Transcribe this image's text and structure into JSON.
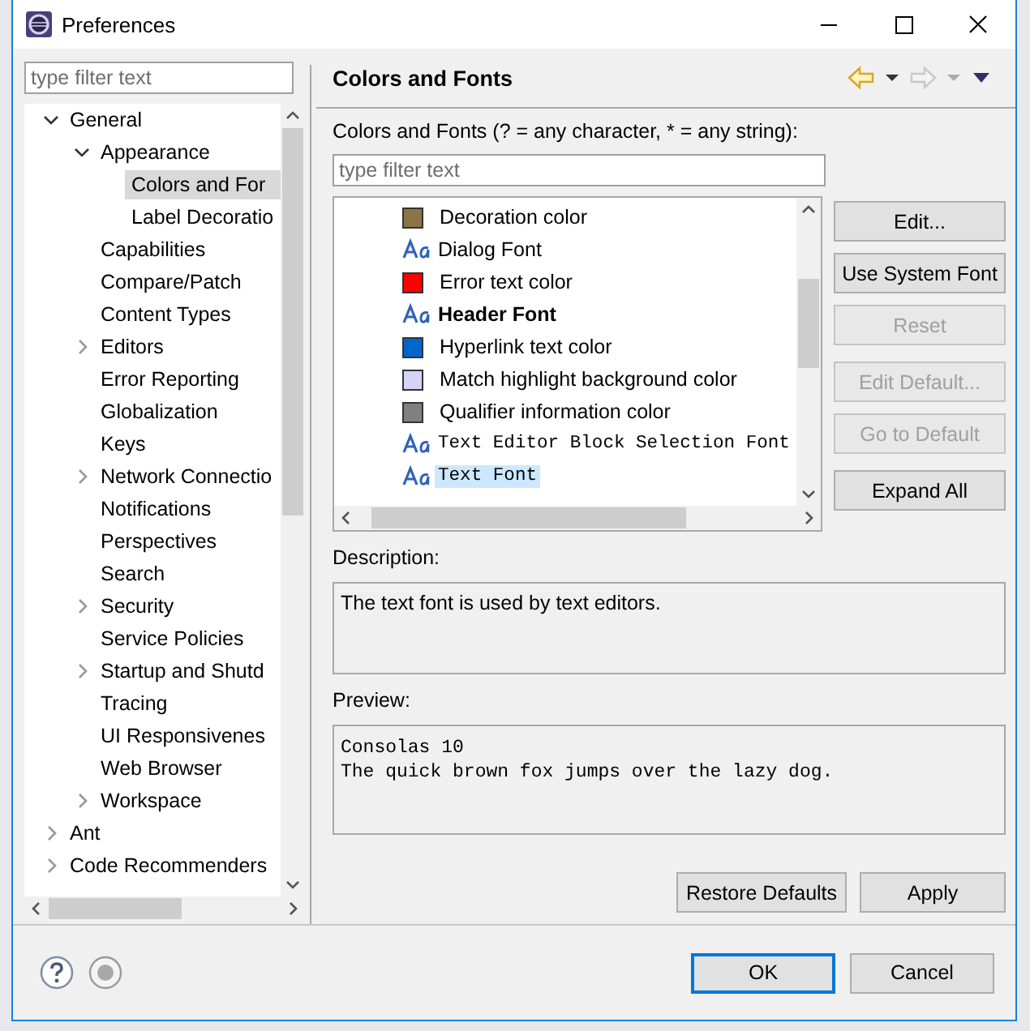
{
  "window": {
    "title": "Preferences"
  },
  "sidebar": {
    "filter": {
      "placeholder": "type filter text"
    },
    "tree": [
      {
        "label": "General",
        "expanded": true,
        "selected": false,
        "children": [
          {
            "label": "Appearance",
            "expanded": true,
            "selected": false,
            "children": [
              {
                "label": "Colors and For",
                "selected": true
              },
              {
                "label": "Label Decoratio",
                "selected": false
              }
            ]
          },
          {
            "label": "Capabilities",
            "selected": false
          },
          {
            "label": "Compare/Patch",
            "selected": false
          },
          {
            "label": "Content Types",
            "selected": false
          },
          {
            "label": "Editors",
            "expanded": false,
            "selected": false
          },
          {
            "label": "Error Reporting",
            "selected": false
          },
          {
            "label": "Globalization",
            "selected": false
          },
          {
            "label": "Keys",
            "selected": false
          },
          {
            "label": "Network Connectio",
            "expanded": false,
            "selected": false
          },
          {
            "label": "Notifications",
            "selected": false
          },
          {
            "label": "Perspectives",
            "selected": false
          },
          {
            "label": "Search",
            "selected": false
          },
          {
            "label": "Security",
            "expanded": false,
            "selected": false
          },
          {
            "label": "Service Policies",
            "selected": false
          },
          {
            "label": "Startup and Shutd",
            "expanded": false,
            "selected": false
          },
          {
            "label": "Tracing",
            "selected": false
          },
          {
            "label": "UI Responsivenes",
            "selected": false
          },
          {
            "label": "Web Browser",
            "selected": false
          },
          {
            "label": "Workspace",
            "expanded": false,
            "selected": false
          }
        ]
      },
      {
        "label": "Ant",
        "expanded": false,
        "selected": false
      },
      {
        "label": "Code Recommenders",
        "expanded": false,
        "selected": false
      }
    ]
  },
  "page": {
    "title": "Colors and Fonts",
    "back": {
      "disabled": false
    },
    "forward": {
      "disabled": true
    },
    "filter_label": "Colors and Fonts (? = any character, * = any string):",
    "filter": {
      "placeholder": "type filter text"
    },
    "items": [
      {
        "kind": "color",
        "label": "Decoration color",
        "color": "#8b7548",
        "selected": false
      },
      {
        "kind": "font",
        "label": "Dialog Font",
        "selected": false
      },
      {
        "kind": "color",
        "label": "Error text color",
        "color": "#ff0000",
        "selected": false
      },
      {
        "kind": "boldfont",
        "label": "Header Font",
        "selected": false
      },
      {
        "kind": "color",
        "label": "Hyperlink text color",
        "color": "#0066cc",
        "selected": false
      },
      {
        "kind": "color",
        "label": "Match highlight background color",
        "color": "#d4d4f8",
        "selected": false
      },
      {
        "kind": "color",
        "label": "Qualifier information color",
        "color": "#808080",
        "selected": false
      },
      {
        "kind": "monofont",
        "label": "Text Editor Block Selection Font",
        "selected": false
      },
      {
        "kind": "monofont",
        "label": "Text Font",
        "selected": true
      }
    ],
    "button_groups": [
      {
        "buttons": [
          {
            "label": "Edit...",
            "disabled": false
          },
          {
            "label": "Use System Font",
            "disabled": false
          },
          {
            "label": "Reset",
            "disabled": true
          }
        ]
      },
      {
        "buttons": [
          {
            "label": "Edit Default...",
            "disabled": true
          },
          {
            "label": "Go to Default",
            "disabled": true
          }
        ]
      },
      {
        "buttons": [
          {
            "label": "Expand All",
            "disabled": false
          }
        ]
      }
    ],
    "description_label": "Description:",
    "description": "The text font is used by text editors.",
    "preview_label": "Preview:",
    "preview": [
      "Consolas 10",
      "The quick brown fox jumps over the lazy dog."
    ],
    "page_buttons": [
      {
        "label": "Restore Defaults"
      },
      {
        "label": "Apply"
      }
    ]
  },
  "dialog_buttons": [
    {
      "label": "OK",
      "default": true
    },
    {
      "label": "Cancel",
      "default": false
    }
  ]
}
